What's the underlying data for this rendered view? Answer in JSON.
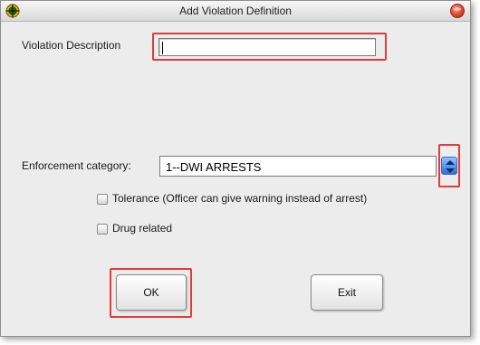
{
  "window": {
    "title": "Add Violation Definition",
    "icons": {
      "app": "crosshair-target-icon",
      "close": "close-orb-icon"
    }
  },
  "form": {
    "description_label": "Violation Description",
    "description_value": "",
    "category_label": "Enforcement category:",
    "category_selected": "1--DWI ARRESTS",
    "tolerance_label": "Tolerance (Officer can give warning instead of arrest)",
    "tolerance_checked": false,
    "drug_label": "Drug related",
    "drug_checked": false
  },
  "buttons": {
    "ok_label": "OK",
    "exit_label": "Exit"
  },
  "colors": {
    "highlight": "#e23b3b",
    "window_bg": "#ececec",
    "spin_blue": "#2f6fd9"
  }
}
